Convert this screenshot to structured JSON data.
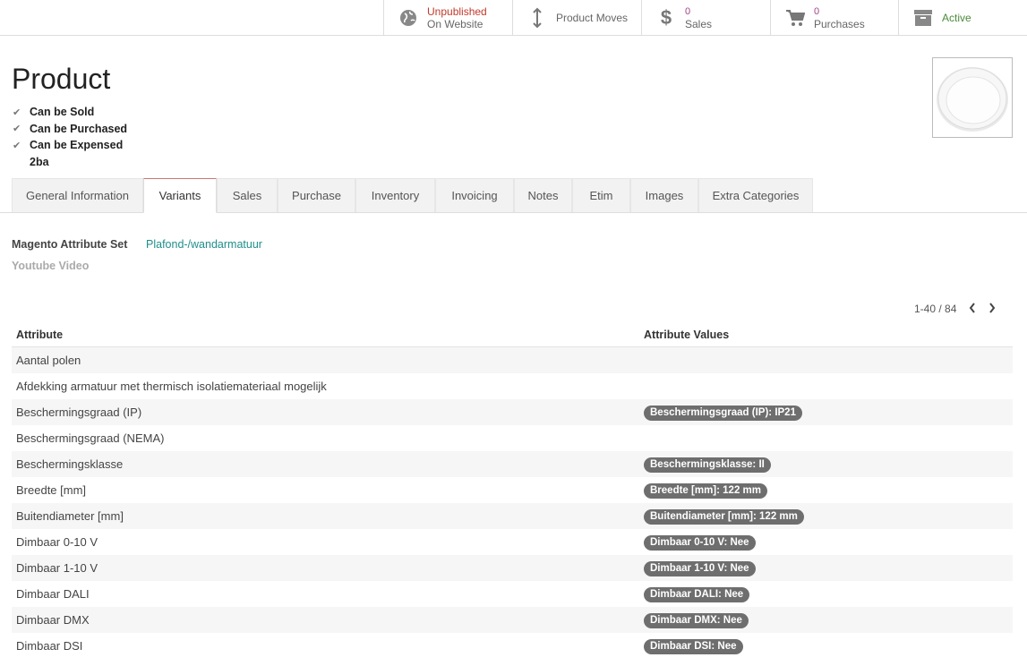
{
  "smart_buttons": {
    "website": {
      "line1": "Unpublished",
      "line2": "On Website",
      "icon": "globe-icon"
    },
    "moves": {
      "label": "Product Moves",
      "icon": "arrows-vertical-icon"
    },
    "sales": {
      "count": "0",
      "label": "Sales",
      "icon": "dollar-icon"
    },
    "purchases": {
      "count": "0",
      "label": "Purchases",
      "icon": "cart-icon"
    },
    "active": {
      "label": "Active",
      "icon": "archive-icon"
    }
  },
  "product": {
    "title": "Product",
    "flags": [
      "Can be Sold",
      "Can be Purchased",
      "Can be Expensed"
    ],
    "code": "2ba"
  },
  "tabs": [
    "General Information",
    "Variants",
    "Sales",
    "Purchase",
    "Inventory",
    "Invoicing",
    "Notes",
    "Etim",
    "Images",
    "Extra Categories"
  ],
  "active_tab": "Variants",
  "fields": {
    "attribute_set_label": "Magento Attribute Set",
    "attribute_set_value": "Plafond-/wandarmatuur",
    "youtube_label": "Youtube Video"
  },
  "pager": {
    "text": "1-40 / 84"
  },
  "table": {
    "headers": [
      "Attribute",
      "Attribute Values"
    ],
    "rows": [
      {
        "attribute": "Aantal polen",
        "value": ""
      },
      {
        "attribute": "Afdekking armatuur met thermisch isolatiemateriaal mogelijk",
        "value": ""
      },
      {
        "attribute": "Beschermingsgraad (IP)",
        "value": "Beschermingsgraad (IP): IP21"
      },
      {
        "attribute": "Beschermingsgraad (NEMA)",
        "value": ""
      },
      {
        "attribute": "Beschermingsklasse",
        "value": "Beschermingsklasse: II"
      },
      {
        "attribute": "Breedte [mm]",
        "value": "Breedte [mm]: 122 mm"
      },
      {
        "attribute": "Buitendiameter [mm]",
        "value": "Buitendiameter [mm]: 122 mm"
      },
      {
        "attribute": "Dimbaar 0-10 V",
        "value": "Dimbaar 0-10 V: Nee"
      },
      {
        "attribute": "Dimbaar 1-10 V",
        "value": "Dimbaar 1-10 V: Nee"
      },
      {
        "attribute": "Dimbaar DALI",
        "value": "Dimbaar DALI: Nee"
      },
      {
        "attribute": "Dimbaar DMX",
        "value": "Dimbaar DMX: Nee"
      },
      {
        "attribute": "Dimbaar DSI",
        "value": "Dimbaar DSI: Nee"
      }
    ]
  },
  "colors": {
    "accent_link": "#1f8f8a",
    "unpublished": "#c0392b",
    "active": "#4b8a3a",
    "badge": "#6e6e6e"
  }
}
